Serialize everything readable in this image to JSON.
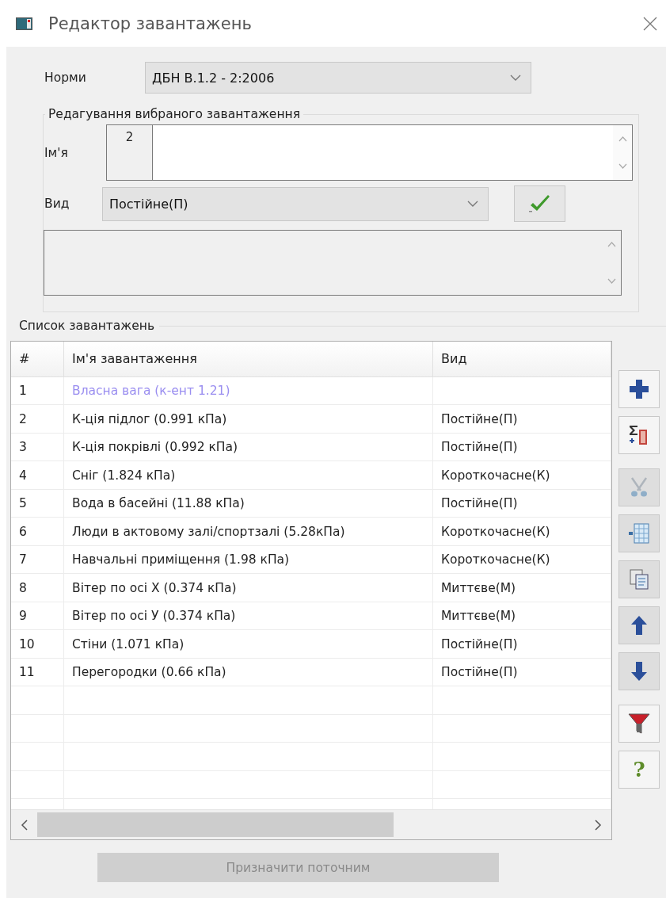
{
  "window": {
    "title": "Редактор завантажень"
  },
  "norms": {
    "label": "Норми",
    "value": "ДБН В.1.2 - 2:2006"
  },
  "edit_group": {
    "title": "Редагування вибраного завантаження",
    "name_label": "Ім'я",
    "number": "2",
    "type_label": "Вид",
    "type_value": "Постійне(П)"
  },
  "list": {
    "title": "Список завантажень",
    "columns": [
      "#",
      "Ім'я завантаження",
      "Вид"
    ],
    "rows": [
      {
        "number": "1",
        "name": "Власна вага (к-ент 1.21)",
        "disabled": true
      },
      {
        "number": "2",
        "name": "К-ція підлог (0.991 кПа)",
        "type": "Постійне(П)",
        "disabled": false
      },
      {
        "number": "3",
        "name": "К-ція покрівлі (0.992 кПа)",
        "type": "Постійне(П)",
        "disabled": false
      },
      {
        "number": "4",
        "name": "Сніг (1.824 кПа)",
        "type": "Короткочасне(К)",
        "disabled": false
      },
      {
        "number": "5",
        "name": "Вода в басейні (11.88 кПа)",
        "type": "Постійне(П)",
        "disabled": false
      },
      {
        "number": "6",
        "name": "Люди в актовому залі/спортзалі (5.28кПа)",
        "type": "Короткочасне(К)",
        "disabled": false
      },
      {
        "number": "7",
        "name": "Навчальні приміщення (1.98 кПа)",
        "type": "Короткочасне(К)",
        "disabled": false
      },
      {
        "number": "8",
        "name": "Вітер по осі Х (0.374 кПа)",
        "type": "Миттєве(М)",
        "disabled": false
      },
      {
        "number": "9",
        "name": "Вітер по осі У (0.374 кПа)",
        "type": "Миттєве(М)",
        "disabled": false
      },
      {
        "number": "10",
        "name": "Стіни (1.071 кПа)",
        "type": "Постійне(П)",
        "disabled": false
      },
      {
        "number": "11",
        "name": "Перегородки (0.66 кПа)",
        "type": "Постійне(П)",
        "disabled": false
      }
    ]
  },
  "toolbar": [
    {
      "kind": "add",
      "disabled": false
    },
    {
      "kind": "sum",
      "disabled": false
    },
    {
      "kind": "cut",
      "disabled": true
    },
    {
      "kind": "insert",
      "disabled": false
    },
    {
      "kind": "copy",
      "disabled": false
    },
    {
      "kind": "up",
      "disabled": false
    },
    {
      "kind": "down",
      "disabled": false
    },
    {
      "kind": "filter",
      "disabled": false
    },
    {
      "kind": "help",
      "label": "?",
      "disabled": false
    }
  ],
  "assign_button": {
    "label": "Призначити поточним",
    "disabled": true
  }
}
